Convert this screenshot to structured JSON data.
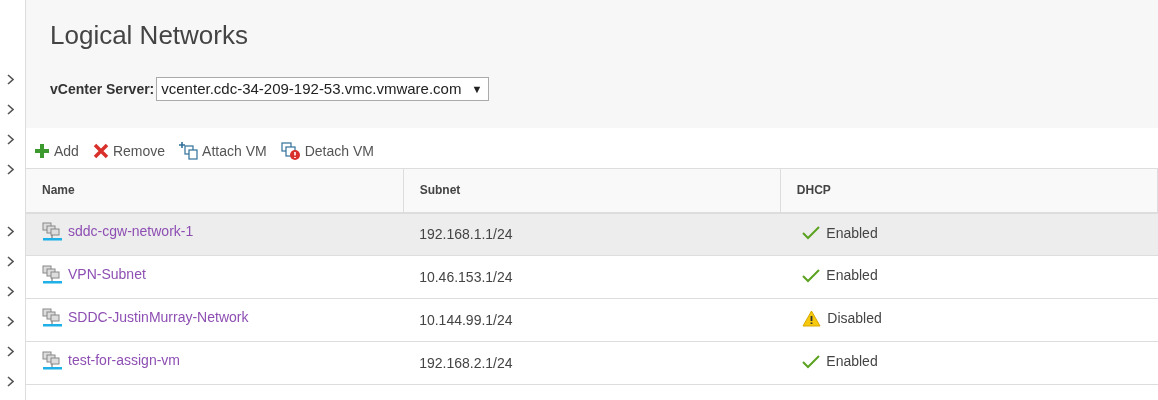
{
  "title": "Logical Networks",
  "vcenter": {
    "label": "vCenter Server:",
    "value": "vcenter.cdc-34-209-192-53.vmc.vmware.com",
    "caret": "▼"
  },
  "toolbar": [
    {
      "kind": "add",
      "label": "Add"
    },
    {
      "kind": "remove",
      "label": "Remove"
    },
    {
      "kind": "attach",
      "label": "Attach VM"
    },
    {
      "kind": "detach",
      "label": "Detach VM"
    }
  ],
  "table": {
    "columns": [
      "Name",
      "Subnet",
      "DHCP"
    ],
    "rows": [
      {
        "name": "sddc-cgw-network-1",
        "subnet": "192.168.1.1/24",
        "dhcp": {
          "kind": "enabled",
          "label": "Enabled"
        },
        "selected": true
      },
      {
        "name": "VPN-Subnet",
        "subnet": "10.46.153.1/24",
        "dhcp": {
          "kind": "enabled",
          "label": "Enabled"
        },
        "selected": false
      },
      {
        "name": "SDDC-JustinMurray-Network",
        "subnet": "10.144.99.1/24",
        "dhcp": {
          "kind": "warning",
          "label": "Disabled"
        },
        "selected": false
      },
      {
        "name": "test-for-assign-vm",
        "subnet": "192.168.2.1/24",
        "dhcp": {
          "kind": "enabled",
          "label": "Enabled"
        },
        "selected": false
      }
    ]
  }
}
